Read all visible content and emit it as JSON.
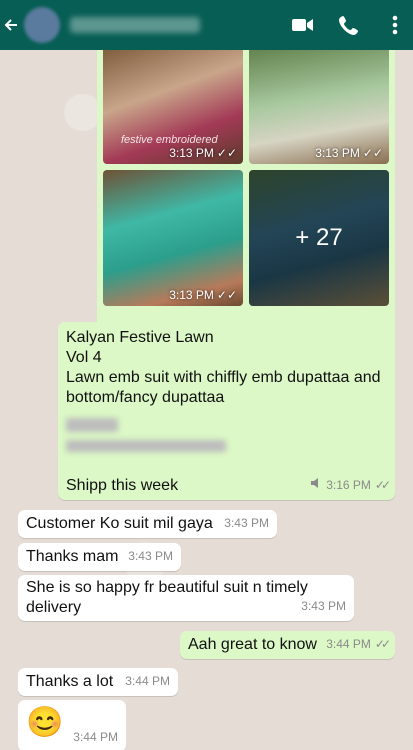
{
  "header": {
    "back_icon": "back-arrow-icon",
    "video_icon": "video-call-icon",
    "call_icon": "phone-icon",
    "menu_icon": "more-vert-icon"
  },
  "media": {
    "tiles": [
      {
        "time": "3:13 PM",
        "ticks": "✓✓"
      },
      {
        "time": "3:13 PM",
        "ticks": "✓✓"
      },
      {
        "time": "3:13 PM",
        "ticks": "✓✓"
      },
      {
        "more": "+ 27"
      }
    ]
  },
  "text_message": {
    "line1": "Kalyan Festive Lawn",
    "line2": "Vol 4",
    "line3": "Lawn emb suit with chiffly emb dupattaa and bottom/fancy dupattaa",
    "line_ship": "Shipp this week",
    "time": "3:16 PM",
    "ticks": "✓✓"
  },
  "messages": [
    {
      "text": "Customer Ko suit mil gaya",
      "time": "3:43 PM"
    },
    {
      "text": "Thanks mam",
      "time": "3:43 PM"
    },
    {
      "text": "She is so happy fr beautiful suit n timely delivery",
      "time": "3:43 PM"
    },
    {
      "text": "Aah great to know",
      "time": "3:44 PM",
      "ticks": "✓✓"
    },
    {
      "text": "Thanks a lot",
      "time": "3:44 PM"
    },
    {
      "text": "😊",
      "time": "3:44 PM"
    }
  ]
}
